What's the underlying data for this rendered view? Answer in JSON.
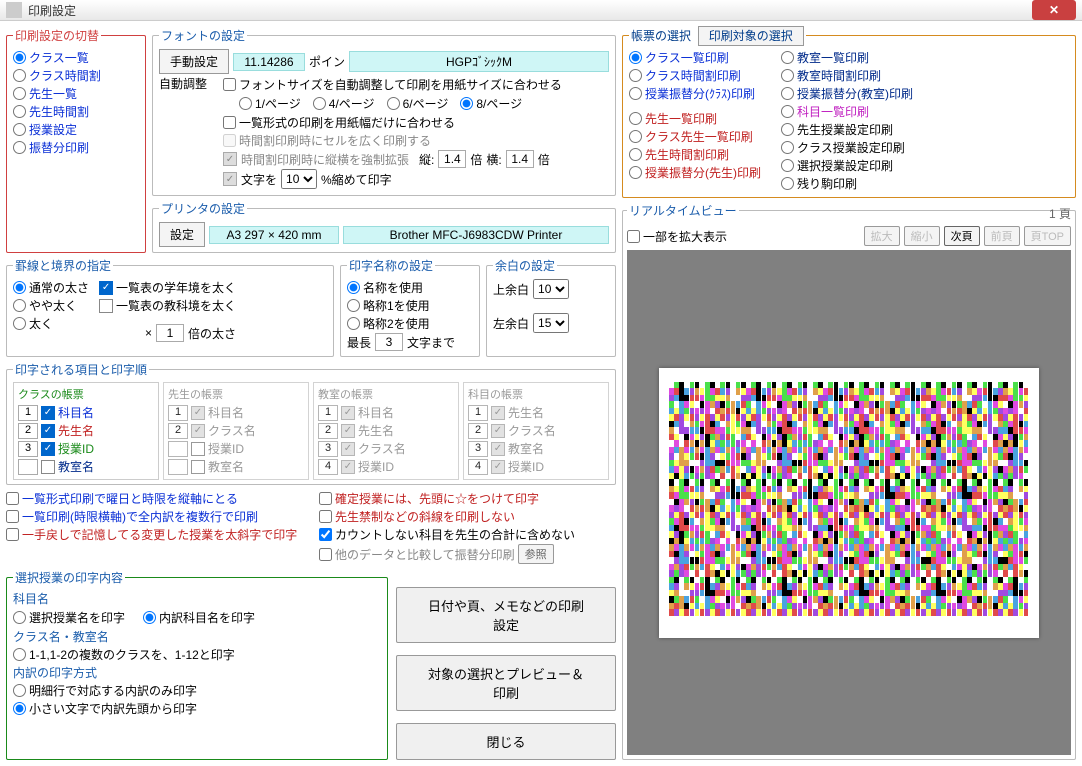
{
  "window": {
    "title": "印刷設定"
  },
  "switch": {
    "legend": "印刷設定の切替",
    "items": [
      "クラス一覧",
      "クラス時間割",
      "先生一覧",
      "先生時間割",
      "授業設定",
      "振替分印刷"
    ],
    "selected": 0
  },
  "font": {
    "legend": "フォントの設定",
    "manual": "手動設定",
    "auto": "自動調整",
    "pt_value": "11.14286",
    "pt_unit": "ポイン",
    "font_name": "HGPｺﾞｼｯｸM",
    "autofit_label": "フォントサイズを自動調整して印刷を用紙サイズに合わせる",
    "per_page_opts": [
      "1/ページ",
      "4/ページ",
      "6/ページ",
      "8/ページ"
    ],
    "per_page_sel": 3,
    "listfit_label": "一覧形式の印刷を用紙幅だけに合わせる",
    "widecell_label": "時間割印刷時にセルを広く印刷する",
    "force_label": "時間割印刷時に縦横を強制拡張",
    "tate": "縦:",
    "tate_v": "1.4",
    "bai": "倍",
    "yoko": "横:",
    "yoko_v": "1.4",
    "scale_label": "文字を",
    "scale_opts": [
      "10"
    ],
    "scale_suffix": "%縮めて印字"
  },
  "printer": {
    "legend": "プリンタの設定",
    "setbtn": "設定",
    "paper": "A3 297 × 420 mm",
    "name": "Brother MFC-J6983CDW Printer"
  },
  "lines": {
    "legend": "罫線と境界の指定",
    "opts": [
      "通常の太さ",
      "やや太く",
      "太く"
    ],
    "selected": 0,
    "grade_border": "一覧表の学年境を太く",
    "subject_border": "一覧表の教科境を太く",
    "times_prefix": "×",
    "times_v": "1",
    "times_suffix": "倍の太さ"
  },
  "print_name": {
    "legend": "印字名称の設定",
    "opts": [
      "名称を使用",
      "略称1を使用",
      "略称2を使用"
    ],
    "selected": 0,
    "max_prefix": "最長",
    "max_v": "3",
    "max_suffix": "文字まで"
  },
  "margin": {
    "legend": "余白の設定",
    "top": "上余白",
    "top_v": "10",
    "left": "左余白",
    "left_v": "15"
  },
  "items": {
    "legend": "印字される項目と印字順",
    "cols": [
      {
        "hdr": "クラスの帳票",
        "cls": "green",
        "active": true,
        "rows": [
          {
            "ord": "1",
            "on": true,
            "lbl": "科目名",
            "cls": "blue"
          },
          {
            "ord": "2",
            "on": true,
            "lbl": "先生名",
            "cls": "red"
          },
          {
            "ord": "3",
            "on": true,
            "lbl": "授業ID",
            "cls": "green"
          },
          {
            "ord": "",
            "on": false,
            "lbl": "教室名",
            "cls": "navy"
          }
        ]
      },
      {
        "hdr": "先生の帳票",
        "cls": "gray",
        "active": false,
        "rows": [
          {
            "ord": "1",
            "on": true,
            "lbl": "科目名"
          },
          {
            "ord": "2",
            "on": true,
            "lbl": "クラス名"
          },
          {
            "ord": "",
            "on": false,
            "lbl": "授業ID"
          },
          {
            "ord": "",
            "on": false,
            "lbl": "教室名"
          }
        ]
      },
      {
        "hdr": "教室の帳票",
        "cls": "gray",
        "active": false,
        "rows": [
          {
            "ord": "1",
            "on": true,
            "lbl": "科目名"
          },
          {
            "ord": "2",
            "on": true,
            "lbl": "先生名"
          },
          {
            "ord": "3",
            "on": true,
            "lbl": "クラス名"
          },
          {
            "ord": "4",
            "on": true,
            "lbl": "授業ID"
          }
        ]
      },
      {
        "hdr": "科目の帳票",
        "cls": "gray",
        "active": false,
        "rows": [
          {
            "ord": "1",
            "on": true,
            "lbl": "先生名"
          },
          {
            "ord": "2",
            "on": true,
            "lbl": "クラス名"
          },
          {
            "ord": "3",
            "on": true,
            "lbl": "教室名"
          },
          {
            "ord": "4",
            "on": true,
            "lbl": "授業ID"
          }
        ]
      }
    ]
  },
  "opts_left": [
    {
      "lbl": "一覧形式印刷で曜日と時限を縦軸にとる",
      "cls": "blue",
      "on": false
    },
    {
      "lbl": "一覧印刷(時限横軸)で全内訳を複数行で印刷",
      "cls": "blue",
      "on": false
    },
    {
      "lbl": "一手戻しで記憶してる変更した授業を太斜字で印字",
      "cls": "red",
      "on": false
    }
  ],
  "opts_right": [
    {
      "lbl": "確定授業には、先頭に☆をつけて印字",
      "cls": "red",
      "on": false
    },
    {
      "lbl": "先生禁制などの斜線を印刷しない",
      "cls": "red",
      "on": false
    },
    {
      "lbl": "カウントしない科目を先生の合計に含めない",
      "cls": "",
      "on": true
    },
    {
      "lbl": "他のデータと比較して振替分印刷",
      "cls": "gray",
      "on": false,
      "btn": "参照"
    }
  ],
  "selection": {
    "legend": "選択授業の印字内容",
    "sub1": "科目名",
    "r1": [
      "選択授業名を印字",
      "内訳科目名を印字"
    ],
    "r1_sel": 1,
    "sub2": "クラス名・教室名",
    "r2": [
      "1-1,1-2の複数のクラスを、1-12と印字"
    ],
    "r2_sel": -1,
    "sub3": "内訳の印字方式",
    "r3": [
      "明細行で対応する内訳のみ印字",
      "小さい文字で内訳先頭から印字"
    ],
    "r3_sel": 1
  },
  "buttons": {
    "date_memo": "日付や頁、メモなどの印刷設定",
    "preview": "対象の選択とプレビュー＆印刷",
    "close": "閉じる"
  },
  "reports": {
    "legend": "帳票の選択",
    "subbtn": "印刷対象の選択",
    "left": [
      {
        "lbl": "クラス一覧印刷",
        "cls": "blue",
        "sel": true
      },
      {
        "lbl": "クラス時間割印刷",
        "cls": "blue"
      },
      {
        "lbl": "授業振替分(ｸﾗｽ)印刷",
        "cls": "blue"
      },
      {
        "lbl": "先生一覧印刷",
        "cls": "red",
        "gap": true
      },
      {
        "lbl": "クラス先生一覧印刷",
        "cls": "red"
      },
      {
        "lbl": "先生時間割印刷",
        "cls": "red"
      },
      {
        "lbl": "授業振替分(先生)印刷",
        "cls": "red"
      }
    ],
    "right": [
      {
        "lbl": "教室一覧印刷",
        "cls": "navy"
      },
      {
        "lbl": "教室時間割印刷",
        "cls": "navy"
      },
      {
        "lbl": "授業振替分(教室)印刷",
        "cls": "navy"
      },
      {
        "lbl": "科目一覧印刷",
        "cls": "magenta"
      },
      {
        "lbl": "先生授業設定印刷",
        "cls": ""
      },
      {
        "lbl": "クラス授業設定印刷",
        "cls": ""
      },
      {
        "lbl": "選択授業設定印刷",
        "cls": ""
      },
      {
        "lbl": "残り駒印刷",
        "cls": ""
      }
    ]
  },
  "realtime": {
    "legend": "リアルタイムビュー",
    "page": "1 頁",
    "zoom_chk": "一部を拡大表示",
    "btns": [
      "拡大",
      "縮小",
      "次頁",
      "前頁",
      "頁TOP"
    ],
    "btn_enabled": [
      false,
      false,
      true,
      false,
      false
    ]
  }
}
